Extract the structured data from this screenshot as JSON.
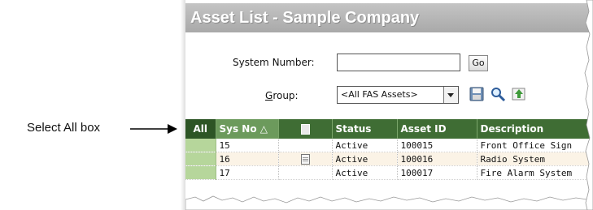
{
  "annotation": {
    "label": "Select All box"
  },
  "window": {
    "title": "Asset List - Sample Company"
  },
  "form": {
    "system_number_label": "System Number:",
    "system_number_value": "",
    "go_label": "Go",
    "group_label_underlined": "G",
    "group_label_rest": "roup:",
    "group_value": "<All FAS Assets>"
  },
  "toolbar_icons": [
    "save-icon",
    "search-icon",
    "export-icon"
  ],
  "grid": {
    "columns": [
      "All",
      "Sys No",
      "",
      "Status",
      "Asset ID",
      "Description"
    ],
    "sort_indicator": "△",
    "rows": [
      {
        "sys_no": "15",
        "has_doc": false,
        "status": "Active",
        "asset_id": "100015",
        "description": "Front Office Sign"
      },
      {
        "sys_no": "16",
        "has_doc": true,
        "status": "Active",
        "asset_id": "100016",
        "description": "Radio System"
      },
      {
        "sys_no": "17",
        "has_doc": false,
        "status": "Active",
        "asset_id": "100017",
        "description": "Fire Alarm System"
      }
    ]
  },
  "colors": {
    "header_green": "#3f6d34",
    "select_cell": "#b6d69b",
    "title_bar": "#b3b3b3"
  }
}
